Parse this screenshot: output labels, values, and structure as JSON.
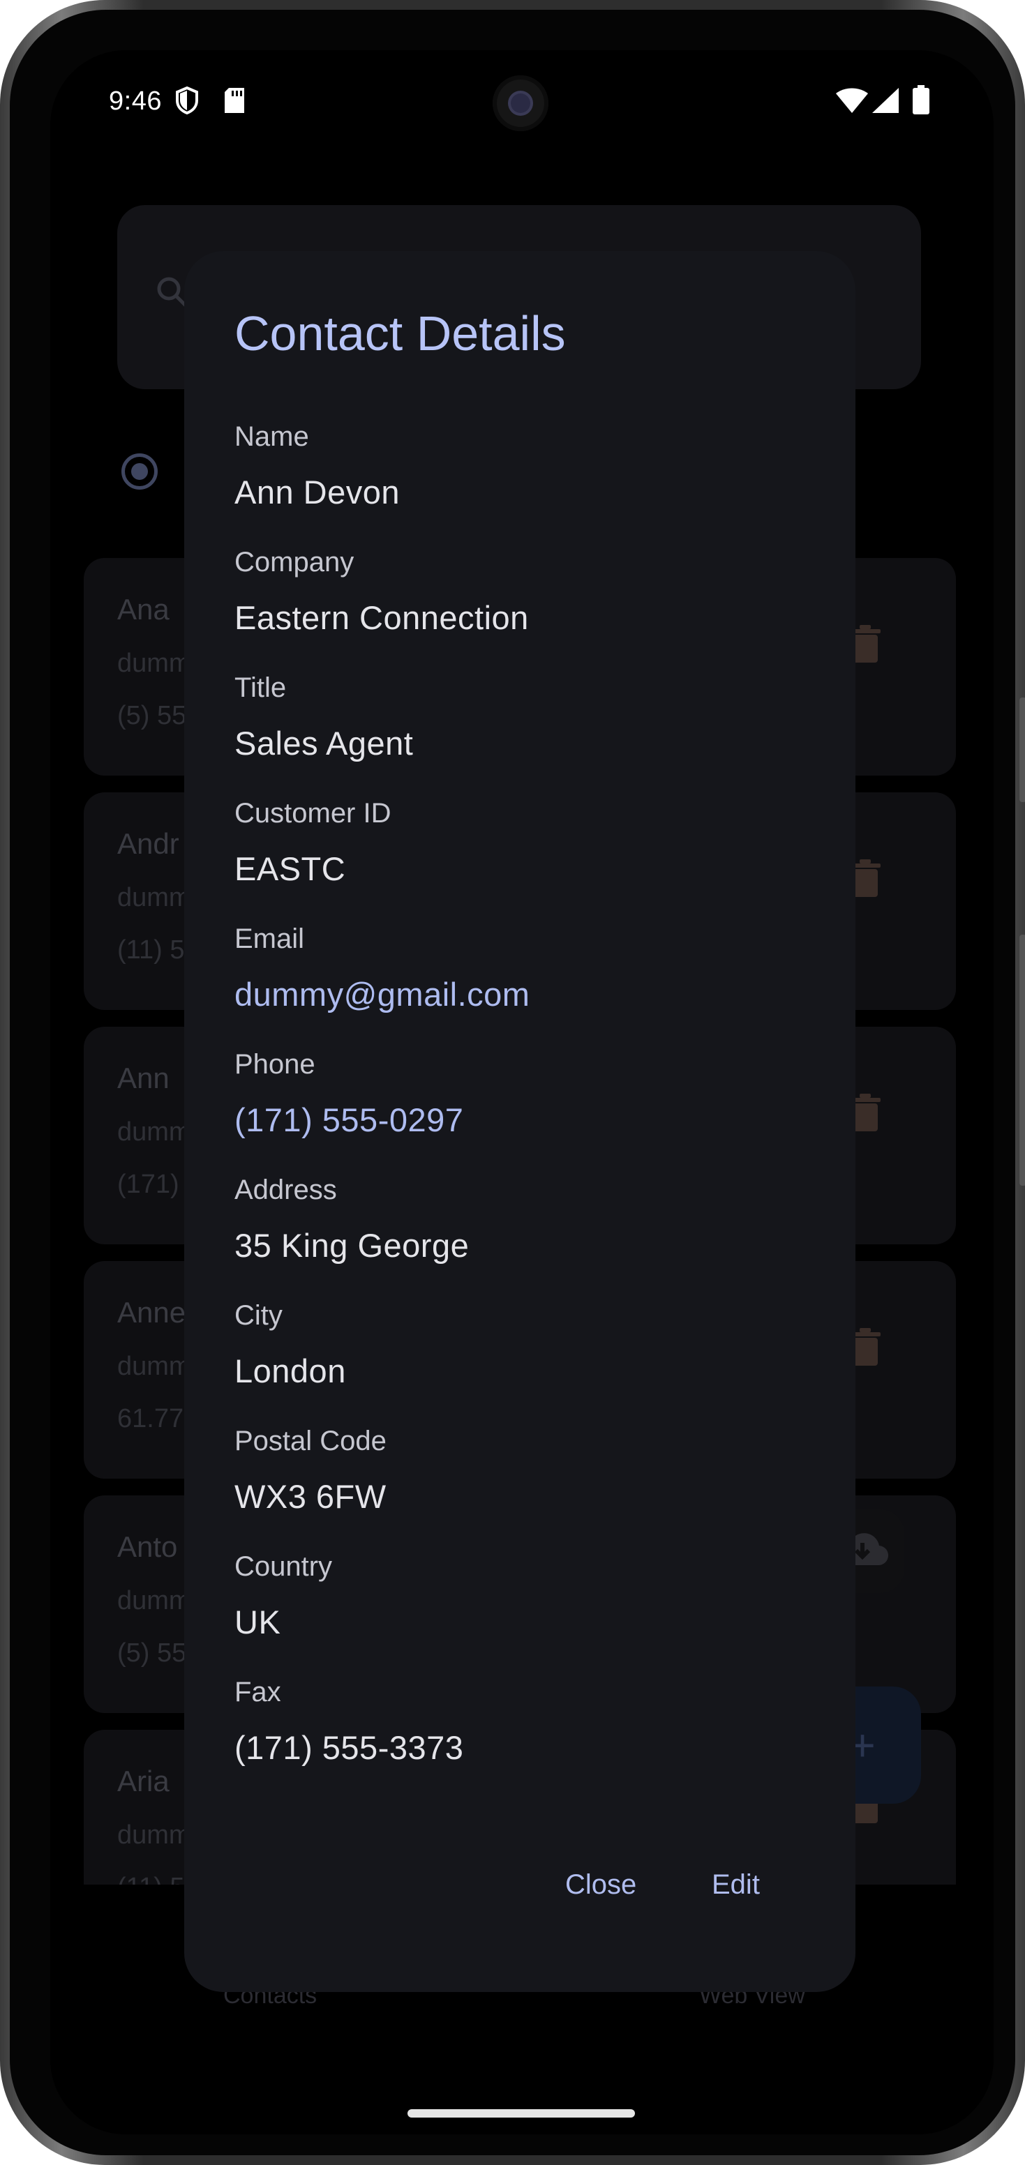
{
  "status_bar": {
    "time": "9:46"
  },
  "background": {
    "cards": [
      {
        "name": "Ana",
        "email": "dumm",
        "phone": "(5) 55"
      },
      {
        "name": "Andr",
        "email": "dumm",
        "phone": "(11) 5"
      },
      {
        "name": "Ann",
        "email": "dumm",
        "phone": "(171)"
      },
      {
        "name": "Anne",
        "email": "dumm",
        "phone": "61.77"
      },
      {
        "name": "Anto",
        "email": "dumm",
        "phone": "(5) 55"
      },
      {
        "name": "Aria",
        "email": "dumm",
        "phone": "(11) 5"
      }
    ],
    "fab_add_symbol": "+",
    "nav": {
      "contacts_label": "Contacts",
      "webview_label": "Web View"
    }
  },
  "dialog": {
    "title": "Contact Details",
    "fields": [
      {
        "label": "Name",
        "value": "Ann Devon"
      },
      {
        "label": "Company",
        "value": "Eastern Connection"
      },
      {
        "label": "Title",
        "value": "Sales Agent"
      },
      {
        "label": "Customer ID",
        "value": "EASTC"
      },
      {
        "label": "Email",
        "value": "dummy@gmail.com"
      },
      {
        "label": "Phone",
        "value": "(171) 555-0297"
      },
      {
        "label": "Address",
        "value": "35 King George"
      },
      {
        "label": "City",
        "value": "London"
      },
      {
        "label": "Postal Code",
        "value": "WX3 6FW"
      },
      {
        "label": "Country",
        "value": "UK"
      },
      {
        "label": "Fax",
        "value": "(171) 555-3373"
      }
    ],
    "close_label": "Close",
    "edit_label": "Edit"
  },
  "colors": {
    "accent": "#b7c4f7",
    "link": "#aebcf0",
    "dialog_bg": "#15161b"
  }
}
